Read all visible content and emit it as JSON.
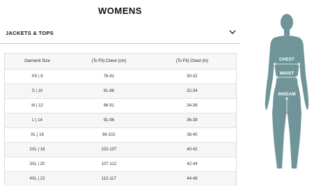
{
  "page": {
    "title": "WOMENS"
  },
  "accordion": {
    "label": "JACKETS & TOPS",
    "icon": "chevron-down-icon"
  },
  "table": {
    "headers": [
      "Garment Size",
      "(To Fit) Chest (cm)",
      "(To Fit) Chest (in)"
    ],
    "rows": [
      [
        "XS | 8",
        "76-81",
        "30-32"
      ],
      [
        "S | 10",
        "81-86",
        "32-34"
      ],
      [
        "M | 12",
        "86-91",
        "34-36"
      ],
      [
        "L | 14",
        "91-96",
        "36-38"
      ],
      [
        "XL | 16",
        "96-102",
        "38-40"
      ],
      [
        "2XL | 18",
        "102-107",
        "40-42"
      ],
      [
        "3XL | 20",
        "107-112",
        "42-44"
      ],
      [
        "4XL | 22",
        "112-117",
        "44-46"
      ]
    ]
  },
  "figure": {
    "labels": {
      "chest": "CHEST",
      "waist": "WAIST",
      "inseam": "INSEAM"
    },
    "body_color": "#6f9599",
    "line_color": "#ffffff"
  }
}
